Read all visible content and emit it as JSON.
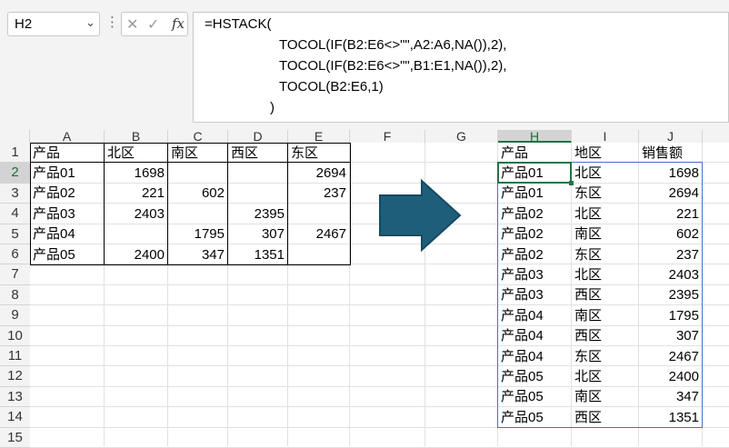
{
  "formula_bar": {
    "name_box": "H2",
    "name_box_chevron": "⌄",
    "more_dots": "⋮",
    "cancel_glyph": "✕",
    "enter_glyph": "✓",
    "fx_label": "fx",
    "formula_lines": [
      "=HSTACK(",
      "TOCOL(IF(B2:E6<>\"\",A2:A6,NA()),2),",
      "TOCOL(IF(B2:E6<>\"\",B1:E1,NA()),2),",
      "TOCOL(B2:E6,1)",
      ")"
    ]
  },
  "columns": [
    "A",
    "B",
    "C",
    "D",
    "E",
    "F",
    "G",
    "H",
    "I",
    "J"
  ],
  "rows": [
    "1",
    "2",
    "3",
    "4",
    "5",
    "6",
    "7",
    "8",
    "9",
    "10",
    "11",
    "12",
    "13",
    "14",
    "15"
  ],
  "selected_column": "H",
  "selected_row": "2",
  "source_table": {
    "header": [
      "产品",
      "北区",
      "南区",
      "西区",
      "东区"
    ],
    "rows": [
      [
        "产品01",
        "1698",
        "",
        "",
        "2694"
      ],
      [
        "产品02",
        "221",
        "602",
        "",
        "237"
      ],
      [
        "产品03",
        "2403",
        "",
        "2395",
        ""
      ],
      [
        "产品04",
        "",
        "1795",
        "307",
        "2467"
      ],
      [
        "产品05",
        "2400",
        "347",
        "1351",
        ""
      ]
    ]
  },
  "result_table": {
    "header": [
      "产品",
      "地区",
      "销售额"
    ],
    "rows": [
      [
        "产品01",
        "北区",
        "1698"
      ],
      [
        "产品01",
        "东区",
        "2694"
      ],
      [
        "产品02",
        "北区",
        "221"
      ],
      [
        "产品02",
        "南区",
        "602"
      ],
      [
        "产品02",
        "东区",
        "237"
      ],
      [
        "产品03",
        "北区",
        "2403"
      ],
      [
        "产品03",
        "西区",
        "2395"
      ],
      [
        "产品04",
        "南区",
        "1795"
      ],
      [
        "产品04",
        "西区",
        "307"
      ],
      [
        "产品04",
        "东区",
        "2467"
      ],
      [
        "产品05",
        "北区",
        "2400"
      ],
      [
        "产品05",
        "南区",
        "347"
      ],
      [
        "产品05",
        "西区",
        "1351"
      ]
    ]
  },
  "colors": {
    "arrow": "#1f5e7a",
    "selection": "#217346",
    "range": "#4472c4"
  }
}
